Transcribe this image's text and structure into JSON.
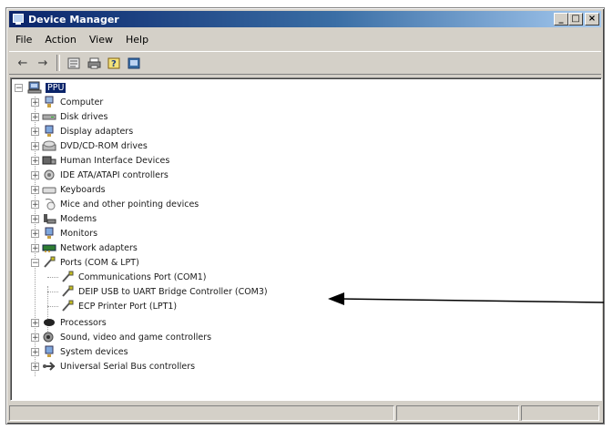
{
  "window": {
    "title": "Device Manager",
    "controls": [
      "minimize-icon",
      "maximize-icon",
      "close-icon"
    ]
  },
  "menu": {
    "items": [
      "File",
      "Action",
      "View",
      "Help"
    ]
  },
  "toolbar": {
    "buttons": [
      "back-icon",
      "forward-icon",
      "properties-icon",
      "print-icon",
      "help-icon",
      "refresh-icon"
    ]
  },
  "tree": {
    "root": "PPU",
    "categories": [
      {
        "label": "Computer",
        "icon": "computer-icon",
        "expanded": false
      },
      {
        "label": "Disk drives",
        "icon": "disk-drive-icon",
        "expanded": false
      },
      {
        "label": "Display adapters",
        "icon": "display-adapter-icon",
        "expanded": false
      },
      {
        "label": "DVD/CD-ROM drives",
        "icon": "dvd-drive-icon",
        "expanded": false
      },
      {
        "label": "Human Interface Devices",
        "icon": "hid-icon",
        "expanded": false
      },
      {
        "label": "IDE ATA/ATAPI controllers",
        "icon": "ide-controller-icon",
        "expanded": false
      },
      {
        "label": "Keyboards",
        "icon": "keyboard-icon",
        "expanded": false
      },
      {
        "label": "Mice and other pointing devices",
        "icon": "mouse-icon",
        "expanded": false
      },
      {
        "label": "Modems",
        "icon": "modem-icon",
        "expanded": false
      },
      {
        "label": "Monitors",
        "icon": "monitor-icon",
        "expanded": false
      },
      {
        "label": "Network adapters",
        "icon": "network-adapter-icon",
        "expanded": false
      },
      {
        "label": "Ports (COM & LPT)",
        "icon": "port-icon",
        "expanded": true
      },
      {
        "label": "Processors",
        "icon": "processor-icon",
        "expanded": false
      },
      {
        "label": "Sound, video and game controllers",
        "icon": "sound-icon",
        "expanded": false
      },
      {
        "label": "System devices",
        "icon": "system-device-icon",
        "expanded": false
      },
      {
        "label": "Universal Serial Bus controllers",
        "icon": "usb-icon",
        "expanded": false
      }
    ],
    "ports_children": [
      "Communications Port (COM1)",
      "DEIP USB to UART Bridge Controller (COM3)",
      "ECP Printer Port (LPT1)"
    ]
  },
  "annotation": {
    "arrow_points_to": "DEIP USB to UART Bridge Controller (COM3)"
  },
  "colors": {
    "title_gradient_start": "#0a246a",
    "title_gradient_end": "#a6caf0",
    "chrome": "#d4d0c8",
    "selection": "#0a246a"
  }
}
